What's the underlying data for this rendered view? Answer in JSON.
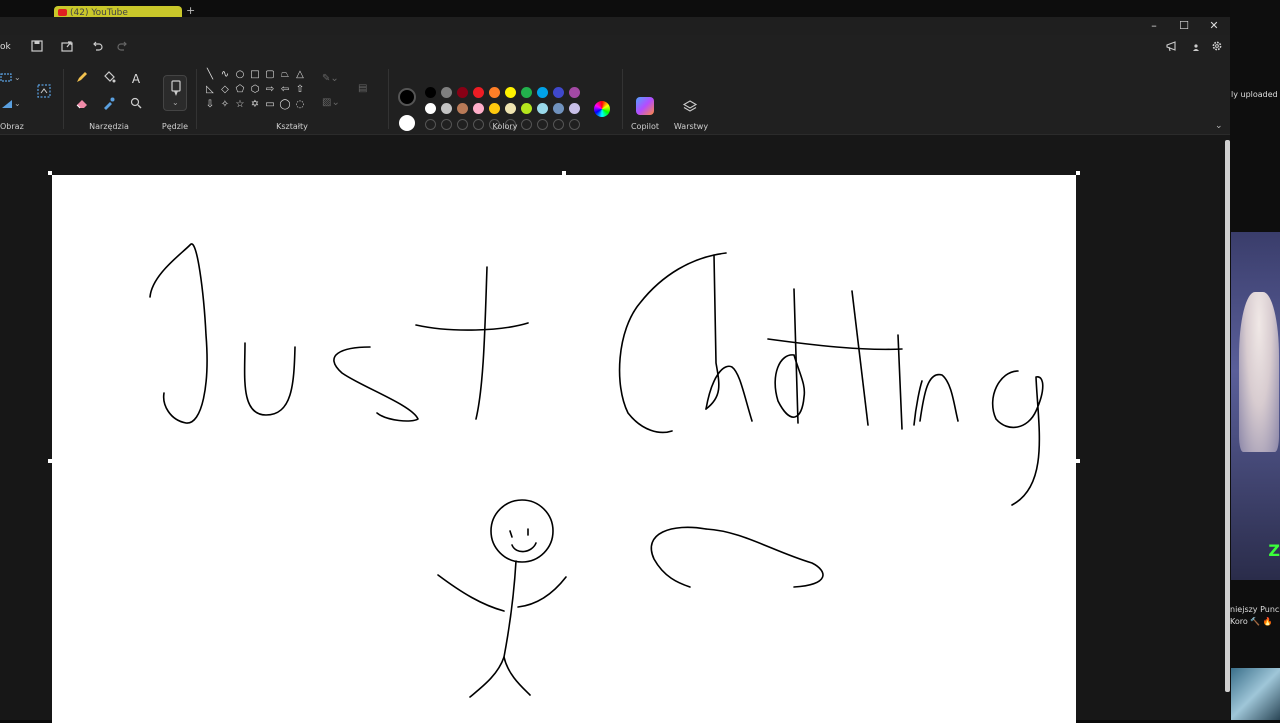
{
  "browser": {
    "tab_title": "(42) YouTube",
    "new_tab": "+"
  },
  "window": {
    "minimize": "–",
    "maximize": "☐",
    "close": "✕"
  },
  "quickbar": {
    "menu_label": "ok",
    "save_icon": "save-icon",
    "share_icon": "share-icon",
    "undo_icon": "undo-icon",
    "redo_icon": "redo-icon",
    "announce_icon": "megaphone-icon",
    "account_icon": "account-icon",
    "settings_icon": "gear-icon"
  },
  "ribbon": {
    "groups": {
      "image": "Obraz",
      "tools": "Narzędzia",
      "brushes": "Pędzle",
      "shapes": "Kształty",
      "colors": "Kolory",
      "copilot": "Copilot",
      "layers": "Warstwy"
    },
    "colors": {
      "current_primary": "#000000",
      "current_secondary": "#ffffff",
      "row1": [
        "#000000",
        "#7f7f7f",
        "#880015",
        "#ed1c24",
        "#ff7f27",
        "#fff200",
        "#22b14c",
        "#00a2e8",
        "#3f48cc",
        "#a349a4"
      ],
      "row2": [
        "#ffffff",
        "#c3c3c3",
        "#b97a57",
        "#ffaec9",
        "#ffc90e",
        "#efe4b0",
        "#b5e61d",
        "#99d9ea",
        "#7092be",
        "#c8bfe7"
      ]
    }
  },
  "right_panel": {
    "uploaded_text": "ly uploaded",
    "video_title_line1": "niejszy Punch",
    "video_title_line2": "Koro 🔨 🔥",
    "thumb_letter": "Z"
  }
}
